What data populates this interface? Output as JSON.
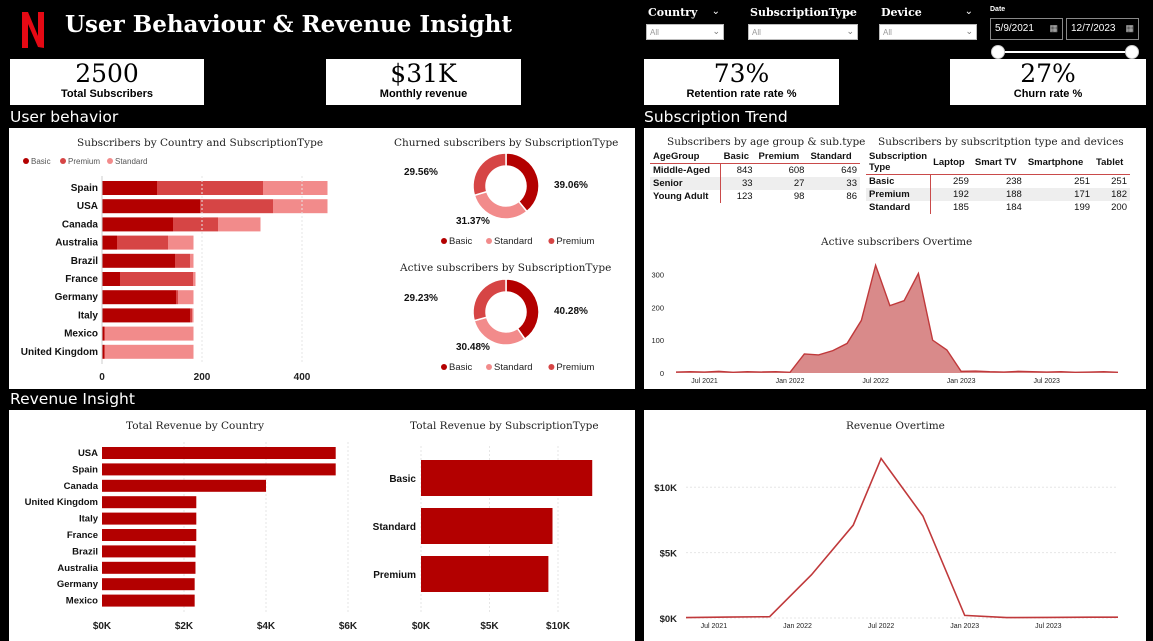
{
  "header": {
    "logo_letter": "N",
    "title": "User Behaviour & Revenue Insight"
  },
  "filters": {
    "country": {
      "label": "Country",
      "value": "All"
    },
    "subscription_type": {
      "label": "SubscriptionType",
      "value": "All"
    },
    "device": {
      "label": "Device",
      "value": "All"
    },
    "date": {
      "label": "Date",
      "start": "5/9/2021",
      "end": "12/7/2023"
    }
  },
  "kpis": {
    "total_subscribers": {
      "value": "2500",
      "label": "Total Subscribers"
    },
    "monthly_revenue": {
      "value": "$31K",
      "label": "Monthly revenue"
    },
    "retention_rate": {
      "value": "73%",
      "label": "Retention rate rate %"
    },
    "churn_rate": {
      "value": "27%",
      "label": "Churn rate %"
    }
  },
  "sections": {
    "user_behavior": "User behavior",
    "subscription_trend": "Subscription Trend",
    "revenue_insight": "Revenue Insight"
  },
  "colors": {
    "basic": "#b30000",
    "premium": "#d64545",
    "standard": "#f28b8b",
    "area": "#d98a8a",
    "line": "#c0393b",
    "bar": "#b30000"
  },
  "chart_data": [
    {
      "id": "subs_by_country",
      "type": "bar",
      "orientation": "horizontal",
      "stacked": true,
      "title": "Subscribers by Country and SubscriptionType",
      "legend": [
        "Basic",
        "Premium",
        "Standard"
      ],
      "legend_position": "top-left",
      "categories": [
        "Spain",
        "USA",
        "Canada",
        "Australia",
        "Brazil",
        "France",
        "Germany",
        "Italy",
        "Mexico",
        "United Kingdom"
      ],
      "series": [
        {
          "name": "Basic",
          "values": [
            110,
            196,
            142,
            30,
            146,
            36,
            148,
            176,
            4,
            4
          ]
        },
        {
          "name": "Premium",
          "values": [
            212,
            146,
            90,
            102,
            30,
            146,
            4,
            4,
            2,
            2
          ]
        },
        {
          "name": "Standard",
          "values": [
            129,
            109,
            85,
            51,
            7,
            5,
            31,
            3,
            177,
            177
          ]
        }
      ],
      "xticks": [
        "0",
        "200",
        "400"
      ],
      "xlim": [
        0,
        450
      ]
    },
    {
      "id": "churned_by_type",
      "type": "pie",
      "donut": true,
      "title": "Churned subscribers by SubscriptionType",
      "labels": [
        "Basic",
        "Standard",
        "Premium"
      ],
      "values": [
        39.06,
        31.37,
        29.56
      ],
      "data_labels": [
        "39.06%",
        "31.37%",
        "29.56%"
      ],
      "legend_position": "bottom"
    },
    {
      "id": "active_by_type",
      "type": "pie",
      "donut": true,
      "title": "Active subscribers by SubscriptionType",
      "labels": [
        "Basic",
        "Standard",
        "Premium"
      ],
      "values": [
        40.28,
        30.48,
        29.23
      ],
      "data_labels": [
        "40.28%",
        "30.48%",
        "29.23%"
      ],
      "legend_position": "bottom"
    },
    {
      "id": "subs_by_age",
      "type": "table",
      "title": "Subscribers by age group & sub.type",
      "columns": [
        "AgeGroup",
        "Basic",
        "Premium",
        "Standard"
      ],
      "rows": [
        [
          "Middle-Aged",
          "843",
          "608",
          "649"
        ],
        [
          "Senior",
          "33",
          "27",
          "33"
        ],
        [
          "Young Adult",
          "123",
          "98",
          "86"
        ]
      ]
    },
    {
      "id": "subs_by_device",
      "type": "table",
      "title": "Subscribers by subscritption type and devices",
      "columns": [
        "Subscription Type",
        "Laptop",
        "Smart TV",
        "Smartphone",
        "Tablet"
      ],
      "rows": [
        [
          "Basic",
          "259",
          "238",
          "251",
          "251"
        ],
        [
          "Premium",
          "192",
          "188",
          "171",
          "182"
        ],
        [
          "Standard",
          "185",
          "184",
          "199",
          "200"
        ]
      ]
    },
    {
      "id": "active_overtime",
      "type": "area",
      "title": "Active subscribers Overtime",
      "x": [
        "2021-05",
        "2021-06",
        "2021-07",
        "2021-08",
        "2021-09",
        "2021-10",
        "2021-11",
        "2021-12",
        "2022-01",
        "2022-02",
        "2022-03",
        "2022-04",
        "2022-05",
        "2022-06",
        "2022-07",
        "2022-08",
        "2022-09",
        "2022-10",
        "2022-11",
        "2022-12",
        "2023-01",
        "2023-02",
        "2023-03",
        "2023-04",
        "2023-05",
        "2023-06",
        "2023-07",
        "2023-08",
        "2023-09",
        "2023-10",
        "2023-11",
        "2023-12"
      ],
      "y": [
        3,
        4,
        3,
        5,
        2,
        4,
        3,
        4,
        2,
        58,
        55,
        68,
        90,
        160,
        328,
        205,
        220,
        303,
        100,
        70,
        5,
        6,
        4,
        3,
        5,
        4,
        3,
        4,
        2,
        3,
        4,
        2
      ],
      "yticks": [
        "0",
        "100",
        "200",
        "300"
      ],
      "xticks": [
        "Jul 2021",
        "Jan 2022",
        "Jul 2022",
        "Jan 2023",
        "Jul 2023"
      ],
      "ylim": [
        0,
        350
      ]
    },
    {
      "id": "revenue_by_country",
      "type": "bar",
      "orientation": "horizontal",
      "title": "Total Revenue by Country",
      "categories": [
        "USA",
        "Spain",
        "Canada",
        "United Kingdom",
        "Italy",
        "France",
        "Brazil",
        "Australia",
        "Germany",
        "Mexico"
      ],
      "values": [
        5700,
        5700,
        4000,
        2300,
        2300,
        2300,
        2280,
        2280,
        2260,
        2260
      ],
      "xticks": [
        "$0K",
        "$2K",
        "$4K",
        "$6K"
      ],
      "xlim": [
        0,
        6000
      ]
    },
    {
      "id": "revenue_by_type",
      "type": "bar",
      "orientation": "horizontal",
      "title": "Total Revenue by SubscriptionType",
      "categories": [
        "Basic",
        "Standard",
        "Premium"
      ],
      "values": [
        12500,
        9600,
        9300
      ],
      "xticks": [
        "$0K",
        "$5K",
        "$10K"
      ],
      "xlim": [
        0,
        12500
      ]
    },
    {
      "id": "revenue_overtime",
      "type": "line",
      "title": "Revenue Overtime",
      "x": [
        "2021-05",
        "2021-08",
        "2021-11",
        "2022-02",
        "2022-05",
        "2022-07",
        "2022-10",
        "2023-01",
        "2023-04",
        "2023-07",
        "2023-10",
        "2023-12"
      ],
      "y": [
        30,
        70,
        100,
        3300,
        7100,
        12200,
        7800,
        200,
        30,
        40,
        60,
        60
      ],
      "yticks": [
        "$0K",
        "$5K",
        "$10K"
      ],
      "xticks": [
        "Jul 2021",
        "Jan 2022",
        "Jul 2022",
        "Jan 2023",
        "Jul 2023"
      ],
      "ylim": [
        0,
        13000
      ]
    }
  ]
}
